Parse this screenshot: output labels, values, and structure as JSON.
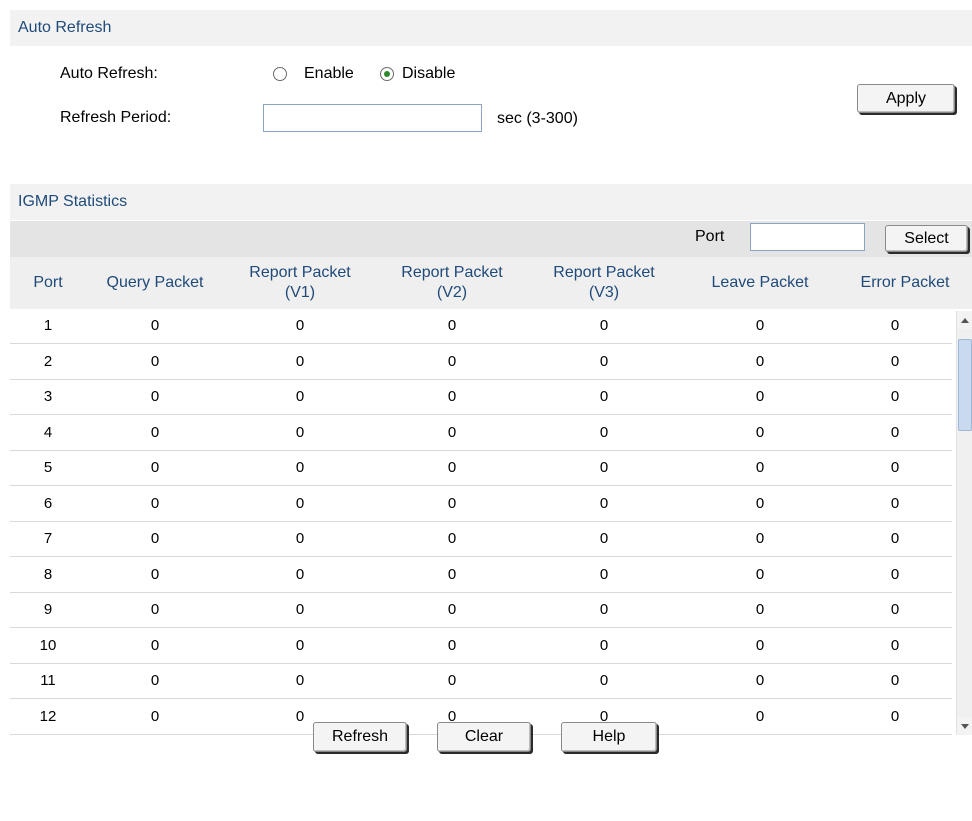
{
  "auto_refresh": {
    "title": "Auto Refresh",
    "auto_refresh_label": "Auto Refresh:",
    "enable_label": "Enable",
    "disable_label": "Disable",
    "selected": "Disable",
    "refresh_period_label": "Refresh Period:",
    "refresh_period_value": "",
    "unit_hint": "sec (3-300)",
    "apply_label": "Apply"
  },
  "statistics": {
    "title": "IGMP Statistics",
    "port_filter_label": "Port",
    "port_filter_value": "",
    "select_label": "Select",
    "columns": [
      {
        "line1": "Port",
        "line2": ""
      },
      {
        "line1": "Query Packet",
        "line2": ""
      },
      {
        "line1": "Report Packet",
        "line2": "(V1)"
      },
      {
        "line1": "Report Packet",
        "line2": "(V2)"
      },
      {
        "line1": "Report Packet",
        "line2": "(V3)"
      },
      {
        "line1": "Leave Packet",
        "line2": ""
      },
      {
        "line1": "Error Packet",
        "line2": ""
      }
    ],
    "rows": [
      [
        "1",
        "0",
        "0",
        "0",
        "0",
        "0",
        "0"
      ],
      [
        "2",
        "0",
        "0",
        "0",
        "0",
        "0",
        "0"
      ],
      [
        "3",
        "0",
        "0",
        "0",
        "0",
        "0",
        "0"
      ],
      [
        "4",
        "0",
        "0",
        "0",
        "0",
        "0",
        "0"
      ],
      [
        "5",
        "0",
        "0",
        "0",
        "0",
        "0",
        "0"
      ],
      [
        "6",
        "0",
        "0",
        "0",
        "0",
        "0",
        "0"
      ],
      [
        "7",
        "0",
        "0",
        "0",
        "0",
        "0",
        "0"
      ],
      [
        "8",
        "0",
        "0",
        "0",
        "0",
        "0",
        "0"
      ],
      [
        "9",
        "0",
        "0",
        "0",
        "0",
        "0",
        "0"
      ],
      [
        "10",
        "0",
        "0",
        "0",
        "0",
        "0",
        "0"
      ],
      [
        "11",
        "0",
        "0",
        "0",
        "0",
        "0",
        "0"
      ],
      [
        "12",
        "0",
        "0",
        "0",
        "0",
        "0",
        "0"
      ]
    ]
  },
  "footer": {
    "refresh_label": "Refresh",
    "clear_label": "Clear",
    "help_label": "Help"
  },
  "colors": {
    "header_text": "#1f4a7a",
    "header_bg": "#f2f2f2",
    "filter_bar_bg": "#e4e4e4",
    "radio_checked": "#2c8a2c"
  }
}
